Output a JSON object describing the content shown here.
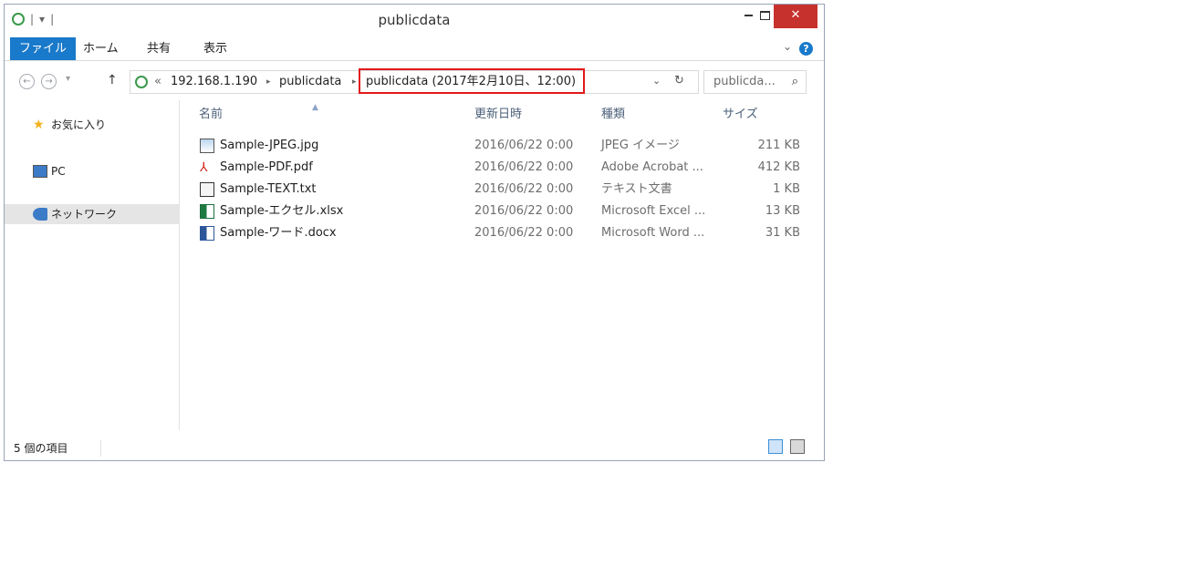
{
  "window": {
    "title": "publicdata",
    "close_glyph": "✕"
  },
  "ribbon": {
    "tabs": [
      "ファイル",
      "ホーム",
      "共有",
      "表示"
    ],
    "help_glyph": "?"
  },
  "address": {
    "prefix": "«",
    "crumbs": [
      "192.168.1.190",
      "publicdata",
      "publicdata (2017年2月10日、12:00)"
    ],
    "separator": "▸",
    "highlight_color": "#e2191b"
  },
  "search": {
    "placeholder": "publicda..."
  },
  "sidebar": {
    "items": [
      {
        "label": "お気に入り",
        "icon": "star-icon"
      },
      {
        "label": "PC",
        "icon": "computer-icon"
      },
      {
        "label": "ネットワーク",
        "icon": "network-icon"
      }
    ],
    "selected_index": 2
  },
  "columns": [
    "名前",
    "更新日時",
    "種類",
    "サイズ"
  ],
  "files": [
    {
      "name": "Sample-JPEG.jpg",
      "date": "2016/06/22 0:00",
      "type": "JPEG イメージ",
      "size": "211 KB",
      "icon": "image-file-icon"
    },
    {
      "name": "Sample-PDF.pdf",
      "date": "2016/06/22 0:00",
      "type": "Adobe Acrobat ...",
      "size": "412 KB",
      "icon": "pdf-file-icon"
    },
    {
      "name": "Sample-TEXT.txt",
      "date": "2016/06/22 0:00",
      "type": "テキスト文書",
      "size": "1 KB",
      "icon": "text-file-icon"
    },
    {
      "name": "Sample-エクセル.xlsx",
      "date": "2016/06/22 0:00",
      "type": "Microsoft Excel ...",
      "size": "13 KB",
      "icon": "excel-file-icon"
    },
    {
      "name": "Sample-ワード.docx",
      "date": "2016/06/22 0:00",
      "type": "Microsoft Word ...",
      "size": "31 KB",
      "icon": "word-file-icon"
    }
  ],
  "status": {
    "item_count": "5 個の項目"
  },
  "colors": {
    "accent": "#1979ca",
    "close_button": "#c7312d",
    "selection": "#e5e5e5"
  }
}
